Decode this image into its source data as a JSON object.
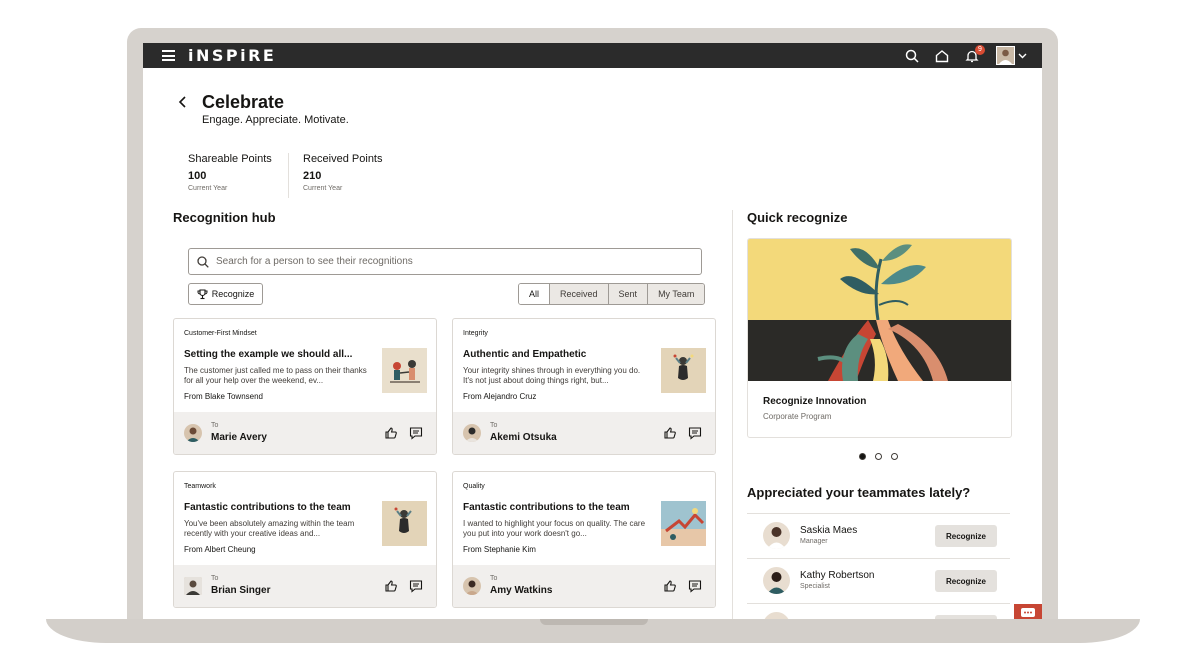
{
  "app": {
    "brand": "iNSPiRE"
  },
  "topbar": {
    "notification_count": "9"
  },
  "header": {
    "title": "Celebrate",
    "subtitle": "Engage. Appreciate. Motivate."
  },
  "points": [
    {
      "label": "Shareable Points",
      "value": "100",
      "period": "Current Year"
    },
    {
      "label": "Received Points",
      "value": "210",
      "period": "Current Year"
    }
  ],
  "hub": {
    "title": "Recognition hub",
    "search_placeholder": "Search for a person to see their recognitions",
    "recognize_label": "Recognize",
    "filters": [
      "All",
      "Received",
      "Sent",
      "My Team"
    ],
    "cards": [
      {
        "category": "Customer-First Mindset",
        "title": "Setting the example we should all...",
        "body": "The customer just called me to pass on their thanks for all your help over the weekend, ev...",
        "from": "From Blake Townsend",
        "to_label": "To",
        "to": "Marie Avery"
      },
      {
        "category": "Integrity",
        "title": "Authentic and Empathetic",
        "body": "Your integrity shines through in everything you do. It's not just about doing things right, but...",
        "from": "From Alejandro Cruz",
        "to_label": "To",
        "to": "Akemi Otsuka"
      },
      {
        "category": "Teamwork",
        "title": "Fantastic contributions to the team",
        "body": "You've been absolutely amazing within the team recently with your creative ideas and...",
        "from": "From Albert Cheung",
        "to_label": "To",
        "to": "Brian Singer"
      },
      {
        "category": "Quality",
        "title": "Fantastic contributions to the team",
        "body": "I wanted to highlight your focus on quality. The care you put into your work doesn't go...",
        "from": "From Stephanie Kim",
        "to_label": "To",
        "to": "Amy Watkins"
      }
    ]
  },
  "quick": {
    "title": "Quick recognize",
    "program_title": "Recognize Innovation",
    "program_sub": "Corporate Program"
  },
  "team": {
    "title": "Appreciated your teammates lately?",
    "button_label": "Recognize",
    "members": [
      {
        "name": "Saskia Maes",
        "role": "Manager"
      },
      {
        "name": "Kathy Robertson",
        "role": "Specialist"
      }
    ]
  },
  "colors": {
    "topbar": "#2b2b2b",
    "accent": "#c74634",
    "art_yellow": "#f3d97a"
  }
}
